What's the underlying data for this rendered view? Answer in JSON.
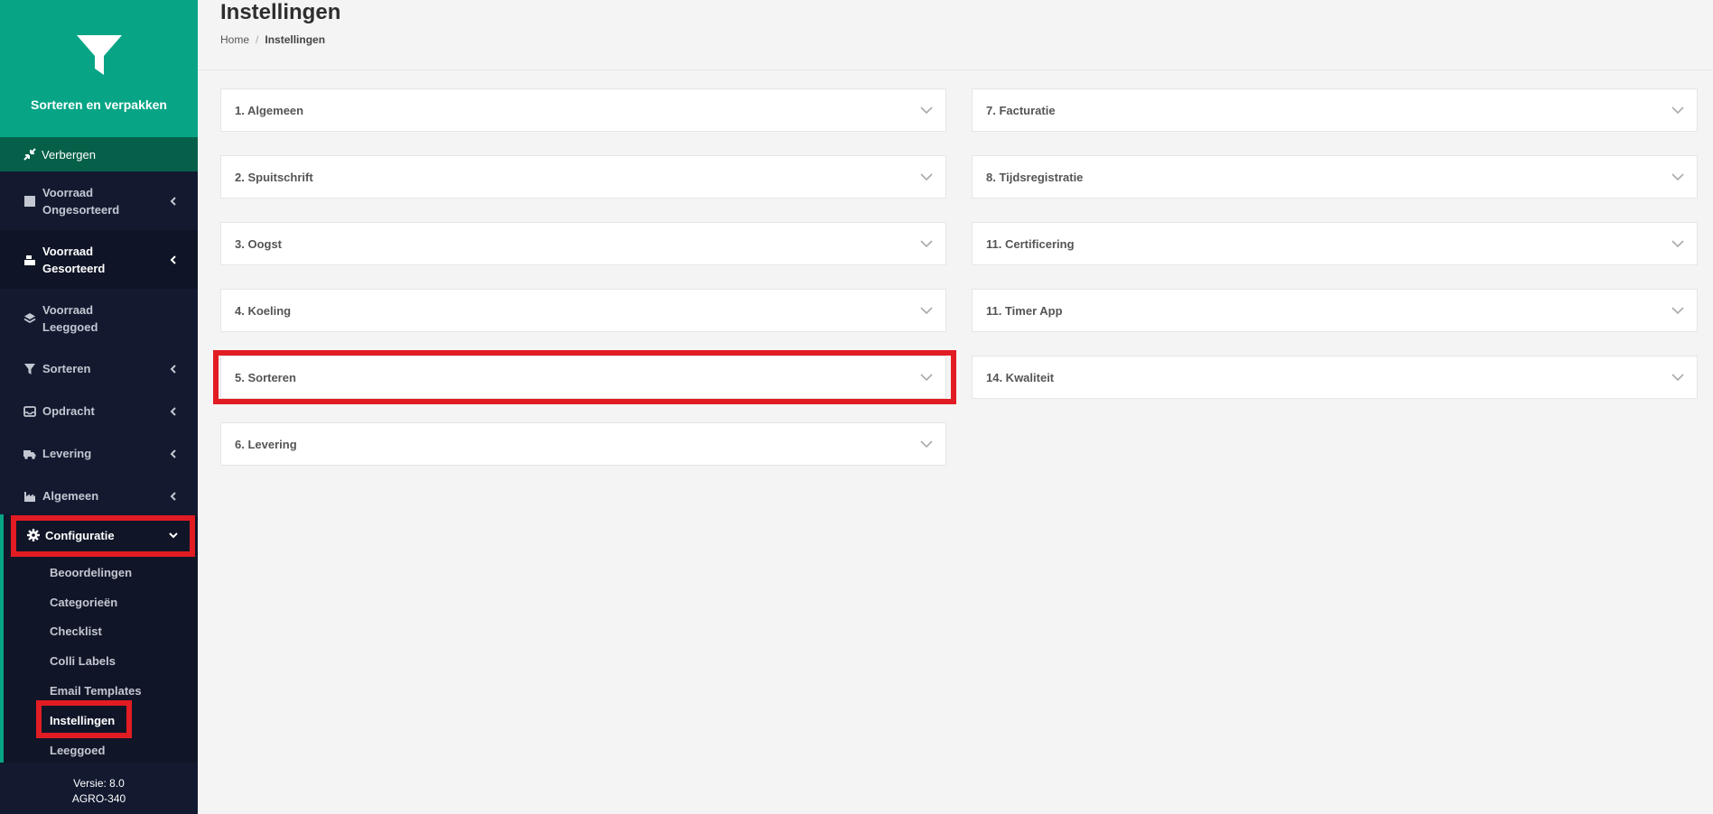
{
  "sidebar": {
    "brand_name": "Sorteren en verpakken",
    "hide_label": "Verbergen",
    "items": [
      {
        "label_line1": "Voorraad",
        "label_line2": "Ongesorteerd",
        "icon": "box-icon"
      },
      {
        "label_line1": "Voorraad",
        "label_line2": "Gesorteerd",
        "icon": "boxes-icon"
      },
      {
        "label_line1": "Voorraad",
        "label_line2": "Leeggoed",
        "icon": "layers-icon"
      },
      {
        "label": "Sorteren",
        "icon": "filter-icon"
      },
      {
        "label": "Opdracht",
        "icon": "inbox-icon"
      },
      {
        "label": "Levering",
        "icon": "truck-icon"
      },
      {
        "label": "Algemeen",
        "icon": "industry-icon"
      }
    ],
    "config": {
      "label": "Configuratie",
      "subitems": [
        "Beoordelingen",
        "Categorieën",
        "Checklist",
        "Colli Labels",
        "Email Templates",
        "Instellingen",
        "Leeggoed"
      ]
    },
    "version_line1": "Versie: 8.0",
    "version_line2": "AGRO-340"
  },
  "header": {
    "title": "Instellingen",
    "breadcrumb_home": "Home",
    "breadcrumb_separator": "/",
    "breadcrumb_current": "Instellingen"
  },
  "panels": {
    "left": [
      "1. Algemeen",
      "2. Spuitschrift",
      "3. Oogst",
      "4. Koeling",
      "5. Sorteren",
      "6. Levering"
    ],
    "right": [
      "7. Facturatie",
      "8. Tijdsregistratie",
      "11. Certificering",
      "11. Timer App",
      "14. Kwaliteit"
    ]
  },
  "colors": {
    "brand_green": "#07a586",
    "sidebar_bg": "#131a30",
    "highlight_red": "#e21c23"
  }
}
